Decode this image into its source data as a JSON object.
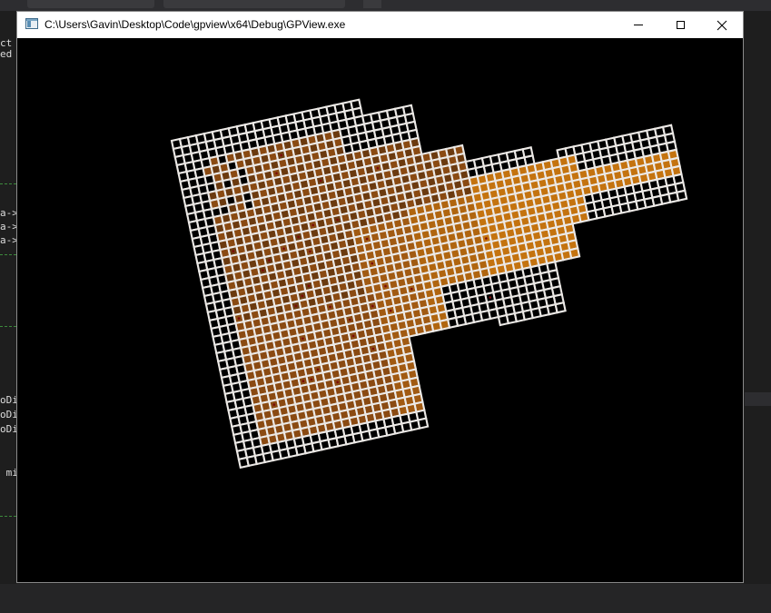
{
  "ide": {
    "code_fragments": [
      {
        "text": "ct"
      },
      {
        "text": "ed"
      },
      {
        "text": "a->"
      },
      {
        "text": "a->"
      },
      {
        "text": "a->"
      },
      {
        "text": "oDi"
      },
      {
        "text": "oDi"
      },
      {
        "text": "oDi"
      },
      {
        "text": " mi"
      }
    ]
  },
  "window": {
    "title": "C:\\Users\\Gavin\\Desktop\\Code\\gpview\\x64\\Debug\\GPView.exe",
    "controls": {
      "minimize": "minimize-icon",
      "maximize": "maximize-icon",
      "close": "close-icon"
    }
  },
  "viewport": {
    "background": "#000000",
    "mesh": {
      "grid_color": "#ece9e6",
      "fill_colors": [
        "#6b3a0f",
        "#8a4a12",
        "#b0650f",
        "#c4730f",
        "#a15a12"
      ],
      "defect_color": "#7a0a0a"
    }
  }
}
